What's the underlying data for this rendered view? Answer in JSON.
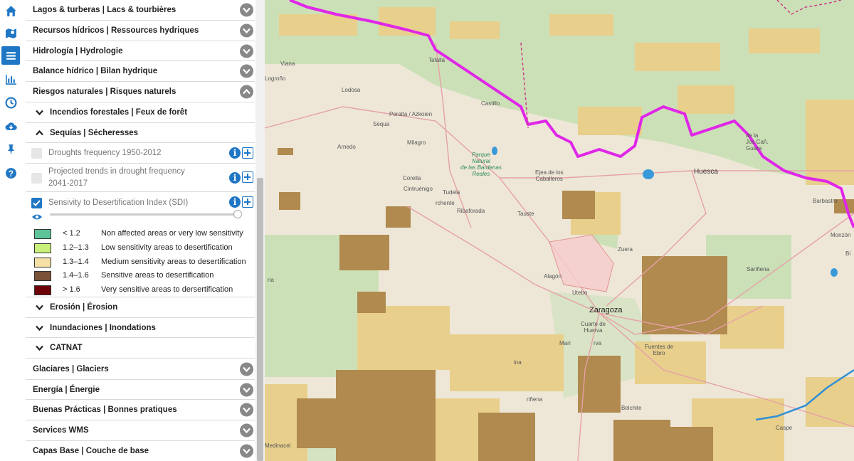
{
  "colors": {
    "accent": "#1f76c4",
    "legend": [
      "#5dc49a",
      "#c8f07a",
      "#f5e0a6",
      "#7a5238",
      "#6e0008"
    ],
    "border_line": "#e026e8"
  },
  "iconbar": [
    {
      "name": "home-icon"
    },
    {
      "name": "map-icon"
    },
    {
      "name": "layers-list-icon",
      "active": true
    },
    {
      "name": "bar-chart-icon"
    },
    {
      "name": "clock-icon"
    },
    {
      "name": "cloud-download-icon"
    },
    {
      "name": "pin-icon"
    },
    {
      "name": "help-icon"
    }
  ],
  "categories": {
    "lagos": "Lagos & turberas | Lacs & tourbières",
    "recursos": "Recursos hídricos | Ressources hydriques",
    "hidrologia": "Hidrología | Hydrologie",
    "balance": "Balance hídrico | Bilan hydrique",
    "riesgos": "Riesgos naturales | Risques naturels",
    "glaciares": "Glaciares | Glaciers",
    "energia": "Energía | Énergie",
    "buenas": "Buenas Prácticas | Bonnes pratiques",
    "wms": "Services WMS",
    "capas": "Capas Base | Couche de base"
  },
  "subgroups": {
    "incendios": "Incendios forestales | Feux de forêt",
    "sequias": "Sequías | Sécheresses",
    "erosion": "Erosión | Érosion",
    "inundaciones": "Inundaciones | Inondations",
    "catnat": "CATNAT"
  },
  "layers": {
    "droughts": {
      "label": "Droughts frequency 1950-2012",
      "checked": false
    },
    "projected_line1": "Projected trends in drought frequency",
    "projected_line2": "2041-2017",
    "sdi": {
      "label": "Sensivity to Desertification Index (SDI)",
      "checked": true,
      "opacity": 1.0
    }
  },
  "legend": [
    {
      "range": "< 1.2",
      "desc": "Non affected areas or very low sensitivity"
    },
    {
      "range": "1.2–1.3",
      "desc": "Low sensitivity areas to desertification"
    },
    {
      "range": "1.3–1.4",
      "desc": "Medium sensitivity areas to desertification"
    },
    {
      "range": "1.4–1.6",
      "desc": "Sensitive areas to desertification"
    },
    {
      "range": "> 1.6",
      "desc": "Very sensitive areas to dersertification"
    }
  ],
  "map_labels": {
    "viana": "Viana",
    "logrono": "Logroño",
    "tafalla": "Tafalla",
    "lodosa": "Lodosa",
    "castillo": "Castillo",
    "peralta": "Peralta / Azkoien",
    "sequa": "Sequa",
    "milagro": "Milagro",
    "arnedo": "Arnedo",
    "park1": "Parque",
    "park2": "Natural",
    "park3": "de las Bardenas",
    "park4": "Reales",
    "ejea1": "Ejea de los",
    "ejea2": "Caballeros",
    "huesca": "Huesca",
    "corella": "Corella",
    "cintruenigo": "Cintruénigo",
    "tudela": "Tudela",
    "arguedas": "rchente",
    "ribaforada": "Ribaforada",
    "barbastro": "Barbastro",
    "monzon": "Monzón",
    "binefar": "Bi",
    "tauste": "Tauste",
    "zuera": "Zuera",
    "sarinena": "Sariñena",
    "alagon": "Alagón",
    "utebo": "Utebo",
    "zaragoza": "Zaragoza",
    "cuarte1": "Cuarte de",
    "cuarte2": "Huerva",
    "maria": "Marí",
    "rva": "rva",
    "fuentes1": "Fuentes de",
    "fuentes2": "Ebro",
    "cariñena": "riñena",
    "belchite": "Belchite",
    "caspe": "Caspe",
    "medinaceli": "Medinacel",
    "gua1": "de la",
    "gua2": "Jos Cañ.",
    "gua3": "Guara",
    "ria": "ria",
    "ina": "ina"
  }
}
